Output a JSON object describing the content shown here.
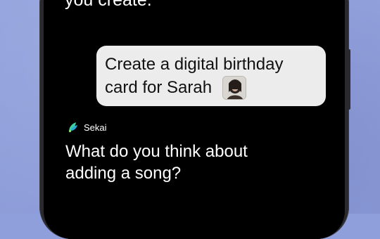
{
  "conversation": {
    "previous_text": "you create.",
    "user_message": {
      "line1": "Create a digital birthday",
      "line2": "card for Sarah"
    },
    "assistant": {
      "name": "Sekai",
      "icon": "sekai-logo-icon",
      "message_line1": "What do you think about",
      "message_line2": "adding a song?"
    }
  },
  "colors": {
    "background": "#8f9fdc",
    "screen": "#000000",
    "user_bubble": "#ececec",
    "assistant_icon": "#3fd1a0"
  }
}
